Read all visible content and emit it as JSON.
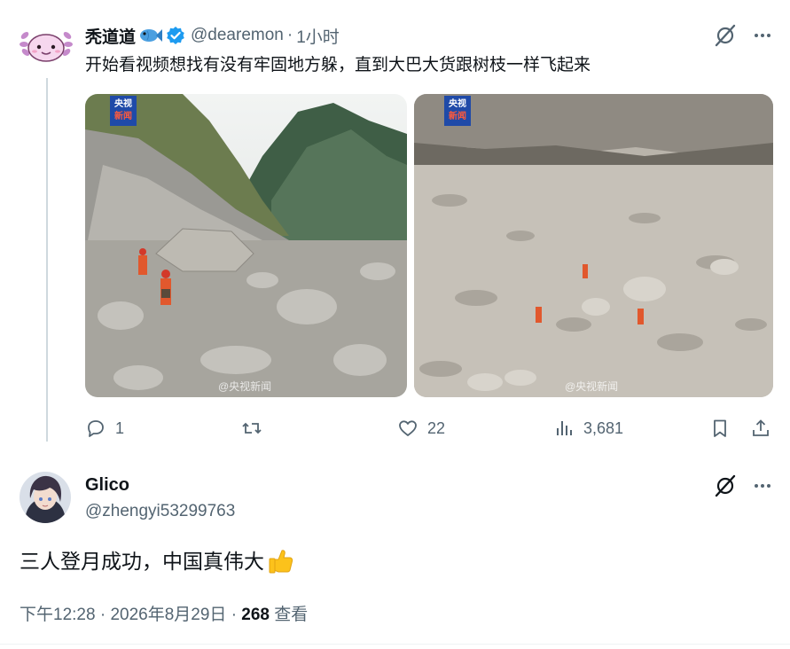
{
  "quoted_tweet": {
    "author_name": "秃道道",
    "author_handle": "@dearemon",
    "separator": "·",
    "time": "1小时",
    "text": "开始看视频想找有没有牢固地方躲，直到大巴大货跟树枝一样飞起来",
    "media": [
      {
        "badge_line1": "央视",
        "badge_line2": "新闻",
        "watermark": "@央视新闻"
      },
      {
        "badge_line1": "央视",
        "badge_line2": "新闻",
        "watermark": "@央视新闻"
      }
    ],
    "actions": {
      "reply_count": "1",
      "retweet_count": "",
      "like_count": "22",
      "view_count": "3,681"
    }
  },
  "main_tweet": {
    "author_name": "Glico",
    "author_handle": "@zhengyi53299763",
    "text": "三人登月成功，中国真伟大",
    "time": "下午12:28",
    "separator": "·",
    "date": "2026年8月29日",
    "separator2": "·",
    "view_count": "268",
    "view_label": "查看"
  },
  "icons": {
    "grok": "grok-icon",
    "more": "more-icon",
    "reply": "reply-icon",
    "retweet": "retweet-icon",
    "like": "heart-icon",
    "views": "analytics-icon",
    "bookmark": "bookmark-icon",
    "share": "share-icon",
    "verified": "verified-badge-icon",
    "emoji_fish": "fish-emoji",
    "emoji_thumb": "thumbs-up-emoji"
  },
  "colors": {
    "text_primary": "#0f1419",
    "text_secondary": "#536471",
    "verified_blue": "#1d9bf0",
    "thread_line": "#cfd9de"
  }
}
